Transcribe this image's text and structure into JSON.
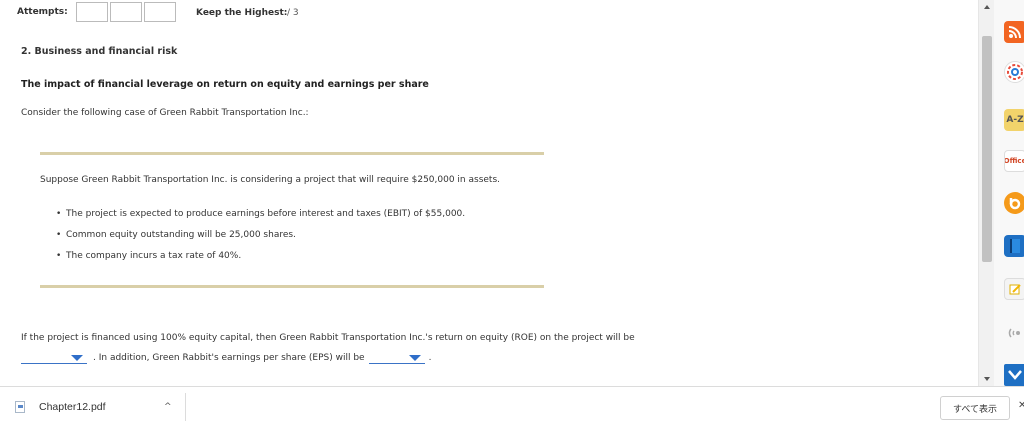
{
  "header": {
    "attempts_label": "Attempts:",
    "keep_label": "Keep the Highest:",
    "keep_value": "/ 3"
  },
  "question": {
    "title": "2. Business and financial risk",
    "subtitle": "The impact of financial leverage on return on equity and earnings per share",
    "intro": "Consider the following case of Green Rabbit Transportation Inc.:",
    "case_text": "Suppose Green Rabbit Transportation Inc. is considering a project that will require $250,000 in assets.",
    "bullets": [
      "The project is expected to produce earnings before interest and taxes (EBIT) of $55,000.",
      "Common equity outstanding will be 25,000 shares.",
      "The company incurs a tax rate of 40%."
    ],
    "prompt_line1": "If the project is financed using 100% equity capital, then Green Rabbit Transportation Inc.'s return on equity (ROE) on the project will be",
    "prompt_mid": ". In addition, Green Rabbit's earnings per share (EPS) will be",
    "prompt_end": "."
  },
  "downloads": {
    "file_name": "Chapter12.pdf",
    "show_all": "すべて表示",
    "close_glyph": "✕"
  },
  "dock": {
    "az_label": "A-Z",
    "office_label": "Office"
  },
  "colors": {
    "rule": "#d9cfa8",
    "dropdown_accent": "#2f6ec9"
  }
}
